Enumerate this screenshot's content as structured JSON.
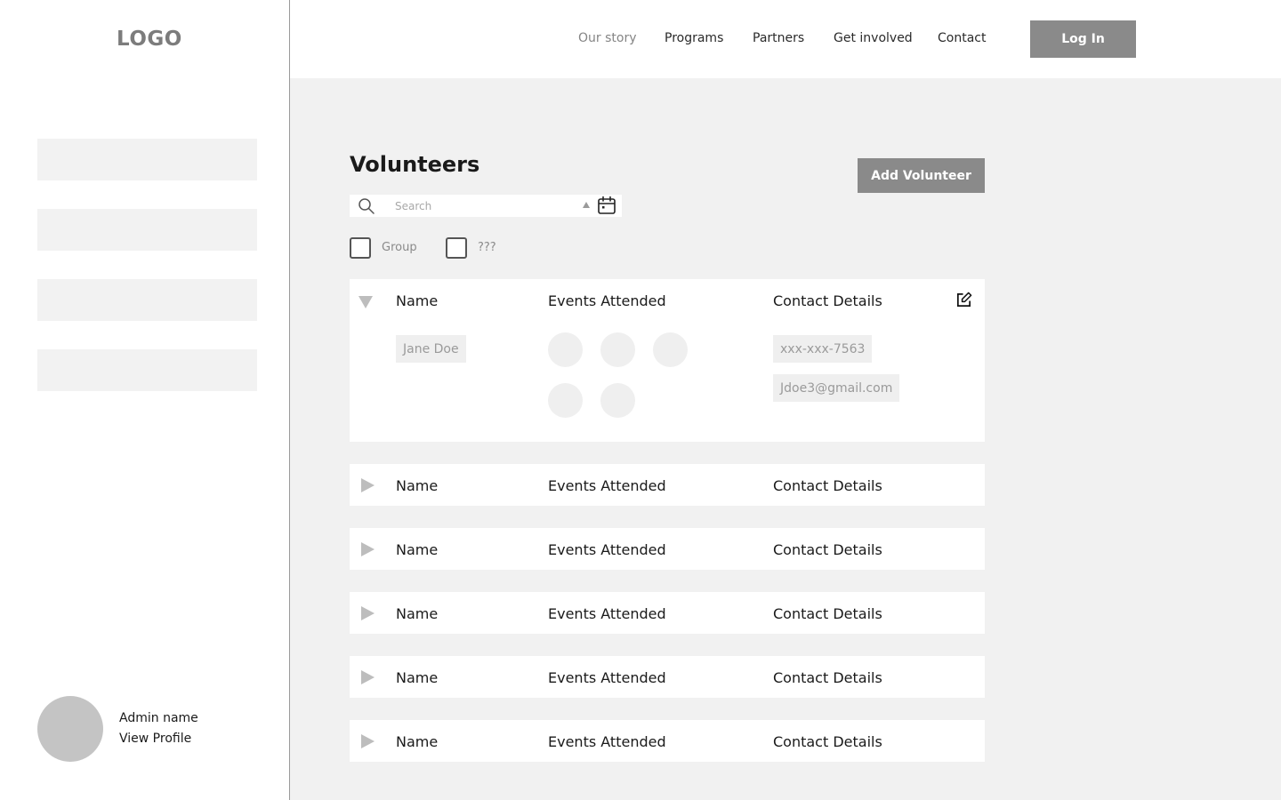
{
  "sidebar": {
    "logo": "LOGO",
    "admin": {
      "name": "Admin name",
      "profile_link": "View Profile"
    }
  },
  "header": {
    "nav": [
      "Our story",
      "Programs",
      "Partners",
      "Get involved",
      "Contact"
    ],
    "login_label": "Log In"
  },
  "main": {
    "title": "Volunteers",
    "add_button": "Add Volunteer",
    "search": {
      "placeholder": "Search"
    },
    "filters": [
      "Group",
      "???"
    ],
    "columns": {
      "name": "Name",
      "events": "Events Attended",
      "contact": "Contact Details"
    },
    "expanded_row": {
      "name": "Jane Doe",
      "phone": "xxx-xxx-7563",
      "email": "Jdoe3@gmail.com",
      "events_count": 5
    },
    "rows": [
      {
        "name": "Name",
        "events": "Events Attended",
        "contact": "Contact Details"
      },
      {
        "name": "Name",
        "events": "Events Attended",
        "contact": "Contact Details"
      },
      {
        "name": "Name",
        "events": "Events Attended",
        "contact": "Contact Details"
      },
      {
        "name": "Name",
        "events": "Events Attended",
        "contact": "Contact Details"
      },
      {
        "name": "Name",
        "events": "Events Attended",
        "contact": "Contact Details"
      }
    ]
  },
  "colors": {
    "accent": "#8a8a8a",
    "panel": "#f1f1f1",
    "placeholder": "#efefef"
  },
  "icons": [
    "search-icon",
    "sort-arrow-icon",
    "calendar-icon",
    "collapse-triangle-icon",
    "expand-triangle-icon",
    "edit-icon"
  ]
}
